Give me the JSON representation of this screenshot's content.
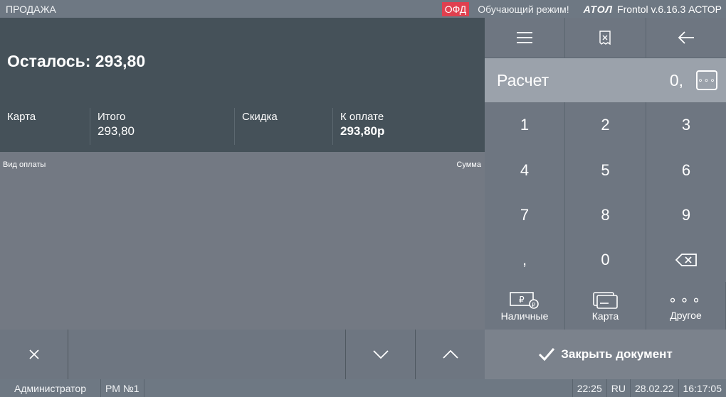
{
  "topbar": {
    "mode": "ПРОДАЖА",
    "ofd_badge": "ОФД",
    "training_mode": "Обучающий режим!",
    "brand": "АТОЛ",
    "version": "Frontol v.6.16.3 АСТОР"
  },
  "summary": {
    "remaining": "Осталось: 293,80",
    "method_label": "Карта",
    "total_label": "Итого",
    "total_value": "293,80",
    "discount_label": "Скидка",
    "to_pay_label": "К оплате",
    "to_pay_value": "293,80р"
  },
  "payments": {
    "col_type": "Вид оплаты",
    "col_sum": "Сумма"
  },
  "panel": {
    "title": "Расчет",
    "amount": "0,",
    "more": "∘∘∘"
  },
  "keypad": {
    "keys": [
      "1",
      "2",
      "3",
      "4",
      "5",
      "6",
      "7",
      "8",
      "9",
      ",",
      "0"
    ],
    "cash": "Наличные",
    "card": "Карта",
    "other": "Другое",
    "other_glyph": "∘∘∘",
    "close_doc": "Закрыть документ"
  },
  "statusbar": {
    "user": "Администратор",
    "workplace": "РМ №1",
    "time_short": "22:25",
    "lang": "RU",
    "date": "28.02.22",
    "time": "16:17:05"
  },
  "colors": {
    "ofd_badge": "#e0404f",
    "header_dark": "#455159",
    "panel_light": "#9ba2ab"
  }
}
